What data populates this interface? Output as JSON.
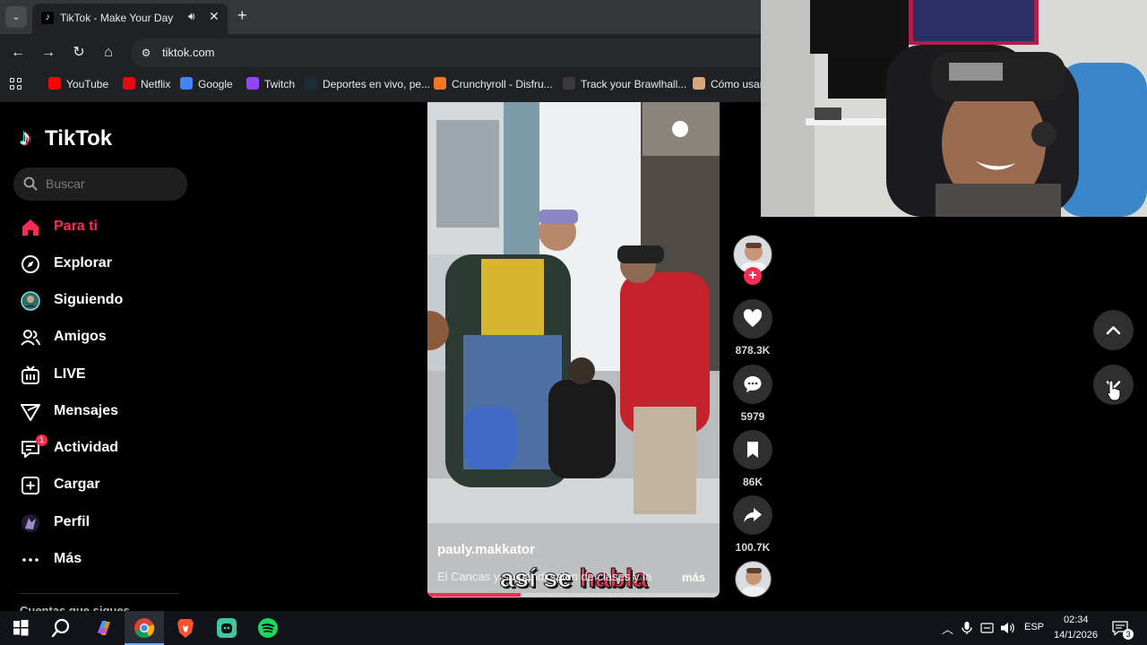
{
  "browser": {
    "tab_title": "TikTok - Make Your Day",
    "url": "tiktok.com",
    "bookmarks": [
      {
        "label": "YouTube",
        "icon": "youtube-icon",
        "color": "#ff0000"
      },
      {
        "label": "Netflix",
        "icon": "netflix-icon",
        "color": "#e50914"
      },
      {
        "label": "Google",
        "icon": "google-icon",
        "color": "#4285f4"
      },
      {
        "label": "Twitch",
        "icon": "twitch-icon",
        "color": "#9146ff"
      },
      {
        "label": "Deportes en vivo, pe...",
        "icon": "sports-icon",
        "color": "#1c2b39"
      },
      {
        "label": "Crunchyroll - Disfru...",
        "icon": "crunchyroll-icon",
        "color": "#f47521"
      },
      {
        "label": "Track your Brawlhall...",
        "icon": "brawlhalla-icon",
        "color": "#3a3a3a"
      },
      {
        "label": "Cómo usar",
        "icon": "page-icon",
        "color": "#d9a57a"
      }
    ]
  },
  "tiktok": {
    "logo_text": "TikTok",
    "search_placeholder": "Buscar",
    "nav": [
      {
        "label": "Para ti",
        "icon": "home-icon",
        "active": true
      },
      {
        "label": "Explorar",
        "icon": "compass-icon"
      },
      {
        "label": "Siguiendo",
        "icon": "avatar-icon"
      },
      {
        "label": "Amigos",
        "icon": "friends-icon"
      },
      {
        "label": "LIVE",
        "icon": "live-icon"
      },
      {
        "label": "Mensajes",
        "icon": "messages-icon"
      },
      {
        "label": "Actividad",
        "icon": "activity-icon",
        "badge": "1"
      },
      {
        "label": "Cargar",
        "icon": "upload-icon"
      },
      {
        "label": "Perfil",
        "icon": "profile-icon"
      },
      {
        "label": "Más",
        "icon": "more-icon"
      }
    ],
    "following_heading": "Cuentas que sigues",
    "accent": "#fe2c55"
  },
  "video": {
    "caption_part1": "así se",
    "caption_part2": "habla",
    "author": "pauly.makkator",
    "description": "El Cancas y su pandi salen de clases y la",
    "more_label": "más",
    "progress": 0.32
  },
  "actions": {
    "likes": "878.3K",
    "comments": "5979",
    "saves": "86K",
    "shares": "100.7K"
  },
  "taskbar": {
    "language": "ESP",
    "time": "02:34",
    "date": "14/1/2026",
    "notifications": "3"
  }
}
